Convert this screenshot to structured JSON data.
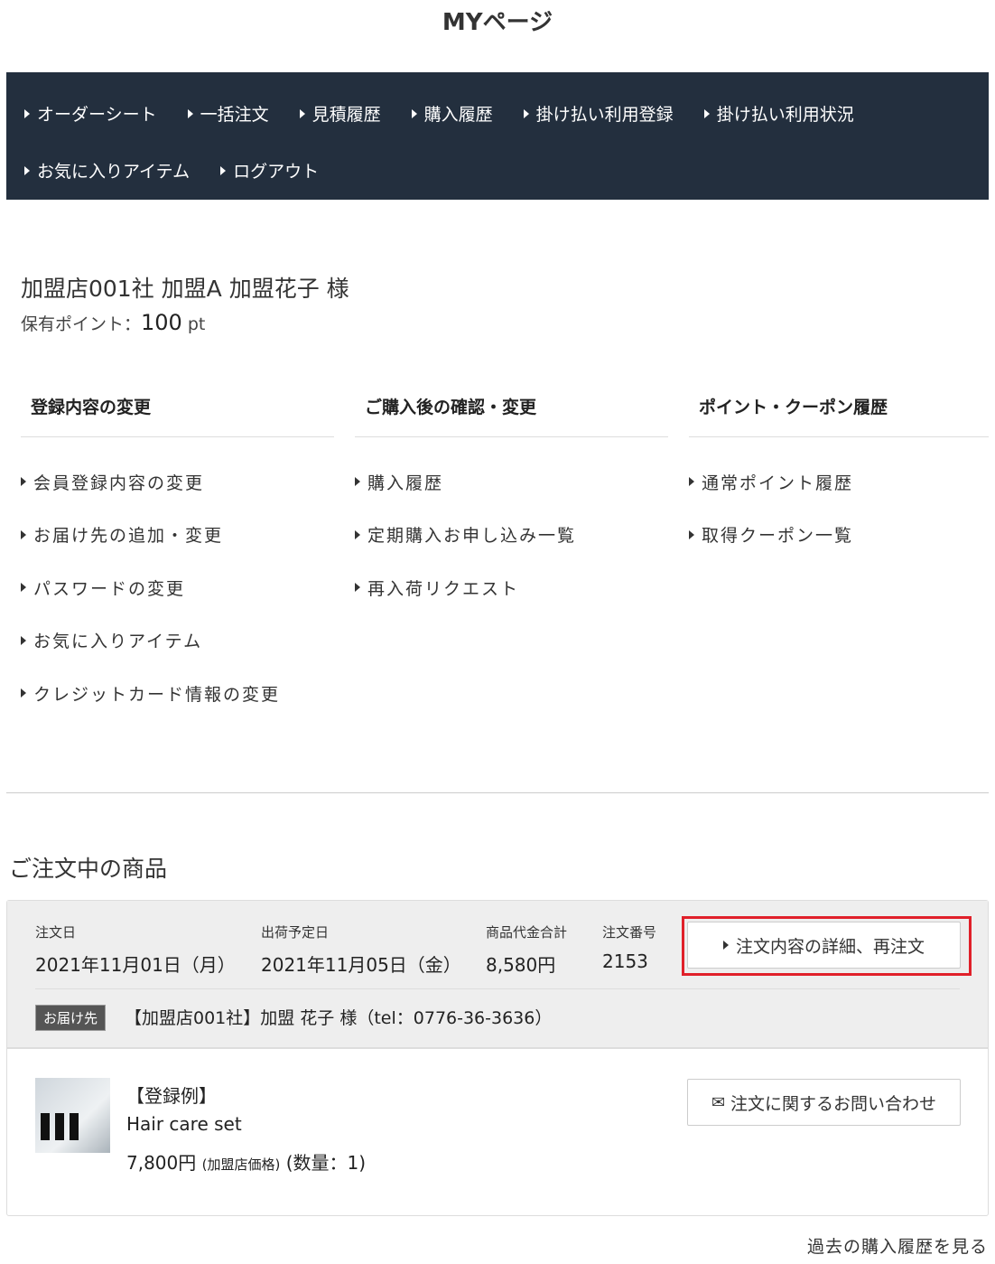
{
  "page_title": "MYページ",
  "nav": {
    "row1": [
      "オーダーシート",
      "一括注文",
      "見積履歴",
      "購入履歴",
      "掛け払い利用登録",
      "掛け払い利用状況"
    ],
    "row2": [
      "お気に入りアイテム",
      "ログアウト"
    ]
  },
  "user": {
    "name": "加盟店001社 加盟A 加盟花子 様",
    "points_label": "保有ポイント：",
    "points_value": "100",
    "points_unit": " pt"
  },
  "columns": [
    {
      "title": "登録内容の変更",
      "items": [
        "会員登録内容の変更",
        "お届け先の追加・変更",
        "パスワードの変更",
        "お気に入りアイテム",
        "クレジットカード情報の変更"
      ]
    },
    {
      "title": "ご購入後の確認・変更",
      "items": [
        "購入履歴",
        "定期購入お申し込み一覧",
        "再入荷リクエスト"
      ]
    },
    {
      "title": "ポイント・クーポン履歴",
      "items": [
        "通常ポイント履歴",
        "取得クーポン一覧"
      ]
    }
  ],
  "orders": {
    "section_title": "ご注文中の商品",
    "order": {
      "date_label": "注文日",
      "date": "2021年11月01日（月）",
      "ship_label": "出荷予定日",
      "ship": "2021年11月05日（金）",
      "total_label": "商品代金合計",
      "total": "8,580円",
      "no_label": "注文番号",
      "no": "2153",
      "detail_button": "注文内容の詳細、再注文",
      "ship_to_badge": "お届け先",
      "ship_to": "【加盟店001社】加盟 花子 様（tel：0776-36-3636）",
      "item": {
        "tag": "【登録例】",
        "name": "Hair care set",
        "price": "7,800円",
        "price_note": "(加盟店価格)",
        "qty": "(数量：1)"
      },
      "inquiry_button": "注文に関するお問い合わせ"
    },
    "history_link": "過去の購入履歴を見る"
  },
  "colors": {
    "nav_bg": "#232f3e",
    "highlight": "#e0202a"
  }
}
